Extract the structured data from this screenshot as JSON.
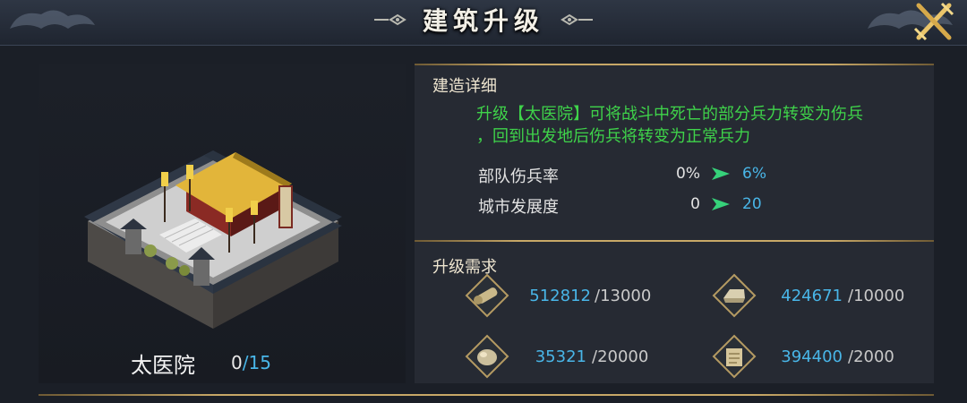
{
  "header": {
    "title": "建筑升级",
    "close_icon": "crossed-swords-close-icon"
  },
  "building": {
    "name": "太医院",
    "current_level": "0",
    "max_level": "/15"
  },
  "details": {
    "title": "建造详细",
    "description_line1": "升级【太医院】可将战斗中死亡的部分兵力转变为伤兵",
    "description_line2": "，回到出发地后伤兵将转变为正常兵力",
    "stats": [
      {
        "label": "部队伤兵率",
        "old": "0%",
        "new": "6%"
      },
      {
        "label": "城市发展度",
        "old": "0",
        "new": "20"
      }
    ]
  },
  "requirements": {
    "title": "升级需求",
    "items": [
      {
        "icon": "wood-log-icon",
        "have": "512812",
        "need": "/13000"
      },
      {
        "icon": "iron-ingot-icon",
        "have": "424671",
        "need": "/10000"
      },
      {
        "icon": "stone-icon",
        "have": "35321",
        "need": "/20000"
      },
      {
        "icon": "grain-scroll-icon",
        "have": "394400",
        "need": "/2000"
      }
    ]
  },
  "colors": {
    "accent_gold": "#c8a867",
    "value_blue": "#49b6e8",
    "desc_green": "#3fd34a"
  }
}
